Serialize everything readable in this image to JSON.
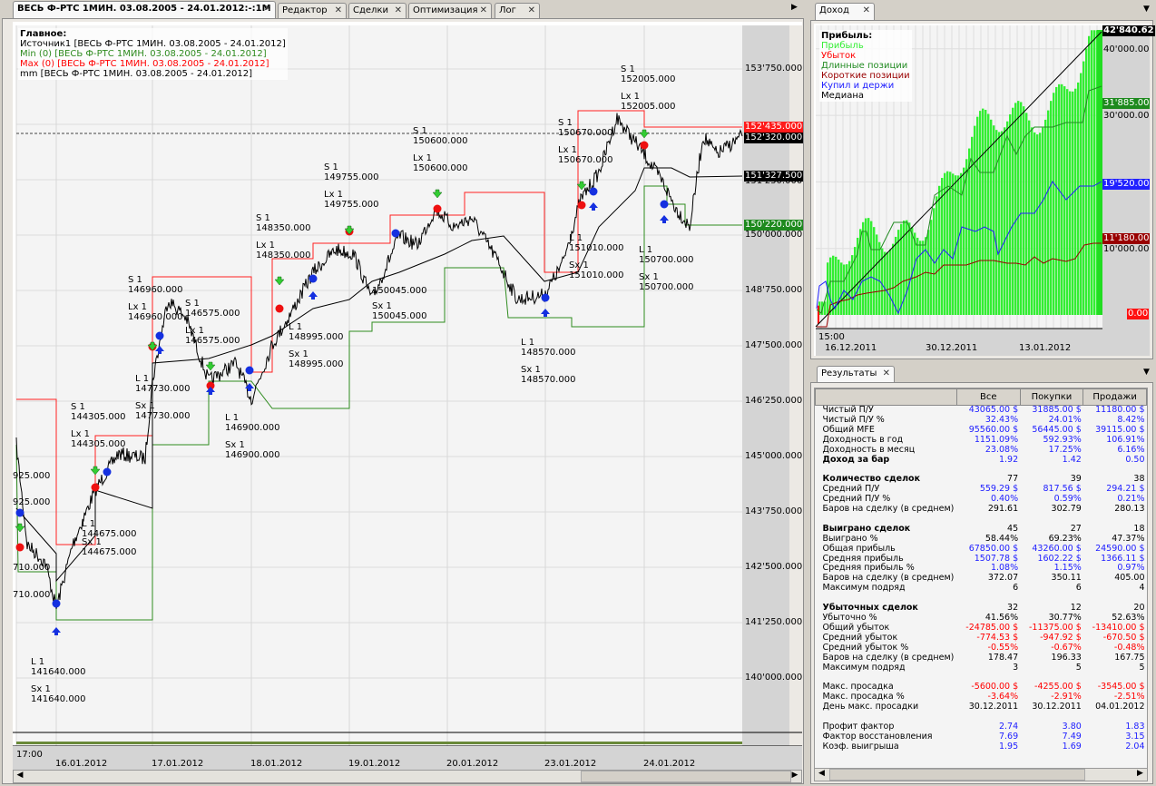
{
  "tabs": [
    {
      "label": "ВЕСЬ Ф-РТС 1МИН. 03.08.2005 - 24.01.2012:-:1М",
      "active": true
    },
    {
      "label": "Редактор"
    },
    {
      "label": "Сделки"
    },
    {
      "label": "Оптимизация"
    },
    {
      "label": "Лог"
    }
  ],
  "main_chart": {
    "legend": {
      "title": "Главное:",
      "items": [
        {
          "label": "Источник1 [ВЕСЬ Ф-РТС 1МИН. 03.08.2005 - 24.01.2012]",
          "color": "#000000"
        },
        {
          "label": "Min (0) [ВЕСЬ Ф-РТС 1МИН. 03.08.2005 - 24.01.2012]",
          "color": "#2e8b1e"
        },
        {
          "label": "Max (0) [ВЕСЬ Ф-РТС 1МИН. 03.08.2005 - 24.01.2012]",
          "color": "#ff0000"
        },
        {
          "label": "mm [ВЕСЬ Ф-РТС 1МИН. 03.08.2005 - 24.01.2012]",
          "color": "#000000"
        }
      ]
    },
    "price_ticks": [
      "153'750.000",
      "150'000.000",
      "148'750.000",
      "147'500.000",
      "146'250.000",
      "145'000.000",
      "143'750.000",
      "142'500.000",
      "141'250.000",
      "140'000.000"
    ],
    "highlights": {
      "max": "152'435.000",
      "last": "152'320.000",
      "mm": "151'327.500",
      "mm_under": "151'250.000",
      "min": "150'220.000"
    },
    "time_label": "17:00",
    "dates": [
      "16.01.2012",
      "17.01.2012",
      "18.01.2012",
      "19.01.2012",
      "20.01.2012",
      "23.01.2012",
      "24.01.2012"
    ],
    "annotations": [
      "S 1\n152005.000",
      "Lx 1\n152005.000",
      "S 1\n150670.000",
      "Lx 1\n150670.000",
      "S 1\n150600.000",
      "Lx 1\n150600.000",
      "S 1\n149755.000",
      "Lx 1\n149755.000",
      "S 1\n148350.000",
      "Lx 1\n148350.000",
      "S 1\n146960.000",
      "Lx 1\n146960.000",
      "S 1\n146575.000",
      "Lx 1\n146575.000",
      "L 1\n147730.000",
      "Sx 1\n147730.000",
      "L 1\n148995.000",
      "Sx 1\n148995.000",
      "150045.000",
      "Sx 1\n150045.000",
      "L 1\n151010.000",
      "Sx 1\n151010.000",
      "L 1\n150700.000",
      "Sx 1\n150700.000",
      "L 1\n148570.000",
      "Sx 1\n148570.000",
      "L 1\n146900.000",
      "Sx 1\n146900.000",
      "S 1\n144305.000",
      "Lx 1\n144305.000",
      "L 1\n144675.000",
      "Sx 1\n144675.000",
      "L 1\n141640.000",
      "Sx 1\n141640.000",
      "925.000",
      "925.000",
      "710.000",
      "710.000"
    ]
  },
  "income": {
    "tab": "Доход",
    "legend": {
      "title": "Прибыль:",
      "items": [
        {
          "label": "Прибыль",
          "color": "#33ee33"
        },
        {
          "label": "Убыток",
          "color": "#ff0000"
        },
        {
          "label": "Длинные позиции",
          "color": "#228b22"
        },
        {
          "label": "Короткие позиции",
          "color": "#990000"
        },
        {
          "label": "Купил и держи",
          "color": "#2020ff"
        },
        {
          "label": "Медиана",
          "color": "#000000"
        }
      ]
    },
    "ticks": [
      "40'000.00",
      "30'000.00",
      "10'000.00"
    ],
    "highlights": {
      "profit": "42'840.62",
      "long": "31'885.00",
      "buyhold": "19'520.00",
      "short": "11'180.00",
      "loss": "0.00"
    },
    "time_label": "15:00",
    "dates": [
      "16.12.2011",
      "30.12.2011",
      "13.01.2012"
    ]
  },
  "results": {
    "tab": "Результаты",
    "columns": [
      "Все",
      "Покупки",
      "Продажи"
    ],
    "rows": [
      {
        "l": "Чистый П/У",
        "v": [
          "43065.00 $",
          "31885.00 $",
          "11180.00 $"
        ],
        "c": "#2020ff"
      },
      {
        "l": "Чистый П/У %",
        "v": [
          "32.43%",
          "24.01%",
          "8.42%"
        ],
        "c": "#2020ff"
      },
      {
        "l": "Общий MFE",
        "v": [
          "95560.00 $",
          "56445.00 $",
          "39115.00 $"
        ],
        "c": "#2020ff"
      },
      {
        "l": "Доходность в год",
        "v": [
          "1151.09%",
          "592.93%",
          "106.91%"
        ],
        "c": "#2020ff"
      },
      {
        "l": "Доходность в месяц",
        "v": [
          "23.08%",
          "17.25%",
          "6.16%"
        ],
        "c": "#2020ff"
      },
      {
        "l": "Доход за бар",
        "v": [
          "1.92",
          "1.42",
          "0.50"
        ],
        "c": "#2020ff",
        "b": true
      },
      {
        "l": "",
        "v": [
          "",
          "",
          ""
        ]
      },
      {
        "l": "Количество сделок",
        "v": [
          "77",
          "39",
          "38"
        ],
        "c": "#000000",
        "b": true
      },
      {
        "l": "Средний П/У",
        "v": [
          "559.29 $",
          "817.56 $",
          "294.21 $"
        ],
        "c": "#2020ff"
      },
      {
        "l": "Средний П/У %",
        "v": [
          "0.40%",
          "0.59%",
          "0.21%"
        ],
        "c": "#2020ff"
      },
      {
        "l": "Баров на сделку (в среднем)",
        "v": [
          "291.61",
          "302.79",
          "280.13"
        ],
        "c": "#000000"
      },
      {
        "l": "",
        "v": [
          "",
          "",
          ""
        ]
      },
      {
        "l": "Выиграно сделок",
        "v": [
          "45",
          "27",
          "18"
        ],
        "c": "#000000",
        "b": true
      },
      {
        "l": "Выиграно %",
        "v": [
          "58.44%",
          "69.23%",
          "47.37%"
        ],
        "c": "#000000"
      },
      {
        "l": "Общая прибыль",
        "v": [
          "67850.00 $",
          "43260.00 $",
          "24590.00 $"
        ],
        "c": "#2020ff"
      },
      {
        "l": "Средняя прибыль",
        "v": [
          "1507.78 $",
          "1602.22 $",
          "1366.11 $"
        ],
        "c": "#2020ff"
      },
      {
        "l": "Средняя прибыль %",
        "v": [
          "1.08%",
          "1.15%",
          "0.97%"
        ],
        "c": "#2020ff"
      },
      {
        "l": "Баров на сделку (в среднем)",
        "v": [
          "372.07",
          "350.11",
          "405.00"
        ],
        "c": "#000000"
      },
      {
        "l": "Максимум подряд",
        "v": [
          "6",
          "6",
          "4"
        ],
        "c": "#000000"
      },
      {
        "l": "",
        "v": [
          "",
          "",
          ""
        ]
      },
      {
        "l": "Убыточных сделок",
        "v": [
          "32",
          "12",
          "20"
        ],
        "c": "#000000",
        "b": true
      },
      {
        "l": "Убыточно %",
        "v": [
          "41.56%",
          "30.77%",
          "52.63%"
        ],
        "c": "#000000"
      },
      {
        "l": "Общий убыток",
        "v": [
          "-24785.00 $",
          "-11375.00 $",
          "-13410.00 $"
        ],
        "c": "#ff0000"
      },
      {
        "l": "Средний убыток",
        "v": [
          "-774.53 $",
          "-947.92 $",
          "-670.50 $"
        ],
        "c": "#ff0000"
      },
      {
        "l": "Средний убыток %",
        "v": [
          "-0.55%",
          "-0.67%",
          "-0.48%"
        ],
        "c": "#ff0000"
      },
      {
        "l": "Баров на сделку (в среднем)",
        "v": [
          "178.47",
          "196.33",
          "167.75"
        ],
        "c": "#000000"
      },
      {
        "l": "Максимум подряд",
        "v": [
          "3",
          "5",
          "5"
        ],
        "c": "#000000"
      },
      {
        "l": "",
        "v": [
          "",
          "",
          ""
        ]
      },
      {
        "l": "Макс. просадка",
        "v": [
          "-5600.00 $",
          "-4255.00 $",
          "-3545.00 $"
        ],
        "c": "#ff0000"
      },
      {
        "l": "Макс. просадка %",
        "v": [
          "-3.64%",
          "-2.91%",
          "-2.51%"
        ],
        "c": "#ff0000"
      },
      {
        "l": "День макс. просадки",
        "v": [
          "30.12.2011",
          "30.12.2011",
          "04.01.2012"
        ],
        "c": "#000000"
      },
      {
        "l": "",
        "v": [
          "",
          "",
          ""
        ]
      },
      {
        "l": "Профит фактор",
        "v": [
          "2.74",
          "3.80",
          "1.83"
        ],
        "c": "#2020ff"
      },
      {
        "l": "Фактор восстановления",
        "v": [
          "7.69",
          "7.49",
          "3.15"
        ],
        "c": "#2020ff"
      },
      {
        "l": "Коэф. выигрыша",
        "v": [
          "1.95",
          "1.69",
          "2.04"
        ],
        "c": "#2020ff"
      }
    ]
  }
}
